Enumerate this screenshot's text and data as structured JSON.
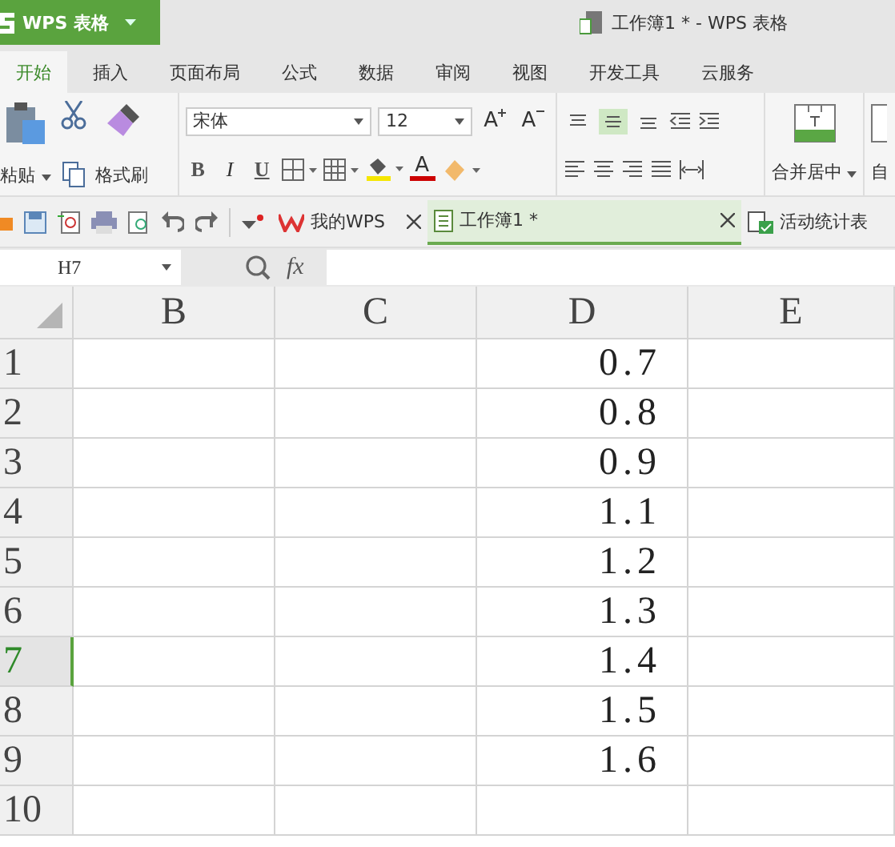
{
  "app_menu": {
    "label": "WPS 表格"
  },
  "window": {
    "title": "工作簿1 * - WPS 表格"
  },
  "menu_tabs": [
    {
      "label": "开始",
      "selected": true
    },
    {
      "label": "插入",
      "selected": false
    },
    {
      "label": "页面布局",
      "selected": false
    },
    {
      "label": "公式",
      "selected": false
    },
    {
      "label": "数据",
      "selected": false
    },
    {
      "label": "审阅",
      "selected": false
    },
    {
      "label": "视图",
      "selected": false
    },
    {
      "label": "开发工具",
      "selected": false
    },
    {
      "label": "云服务",
      "selected": false
    }
  ],
  "ribbon": {
    "paste": "粘贴",
    "format_painter": "格式刷",
    "font_name": "宋体",
    "font_size": "12",
    "grow_font": "A",
    "shrink_font": "A",
    "bold": "B",
    "italic": "I",
    "underline": "U",
    "font_color": "A",
    "merge_center": "合并居中",
    "wrap_text": "自",
    "vertical_align": [
      {
        "selected": false
      },
      {
        "selected": true
      },
      {
        "selected": false
      }
    ]
  },
  "doc_tabs": [
    {
      "label": "我的WPS",
      "selected": false
    },
    {
      "label": "工作簿1 *",
      "selected": true
    },
    {
      "label": "活动统计表",
      "selected": false
    }
  ],
  "formula_bar": {
    "cell_ref": "H7",
    "fx": "fx"
  },
  "grid": {
    "columns": [
      "B",
      "C",
      "D",
      "E"
    ],
    "rows": [
      {
        "number": "1",
        "d": "0.7",
        "selected": false
      },
      {
        "number": "2",
        "d": "0.8",
        "selected": false
      },
      {
        "number": "3",
        "d": "0.9",
        "selected": false
      },
      {
        "number": "4",
        "d": "1.1",
        "selected": false
      },
      {
        "number": "5",
        "d": "1.2",
        "selected": false
      },
      {
        "number": "6",
        "d": "1.3",
        "selected": false
      },
      {
        "number": "7",
        "d": "1.4",
        "selected": true
      },
      {
        "number": "8",
        "d": "1.5",
        "selected": false
      },
      {
        "number": "9",
        "d": "1.6",
        "selected": false
      },
      {
        "number": "10",
        "selected": false
      }
    ]
  }
}
